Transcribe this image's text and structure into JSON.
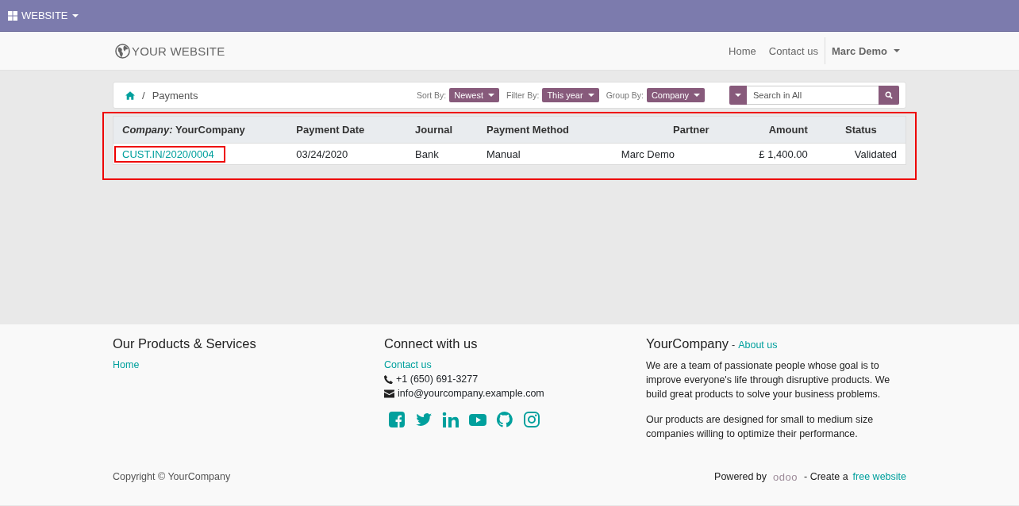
{
  "admin_bar": {
    "app_menu": "WEBSITE"
  },
  "header": {
    "logo": "YOUR WEBSITE",
    "nav": [
      "Home",
      "Contact us"
    ],
    "user": "Marc Demo"
  },
  "breadcrumb": {
    "separator": "/",
    "current": "Payments"
  },
  "controls": [
    {
      "label": "Sort By:",
      "value": "Newest"
    },
    {
      "label": "Filter By:",
      "value": "This year"
    },
    {
      "label": "Group By:",
      "value": "Company"
    }
  ],
  "search": {
    "placeholder": "Search in All"
  },
  "table": {
    "highlighted": true,
    "columns": [
      "*Company:* YourCompany",
      "Payment Date",
      "Journal",
      "Payment Method",
      "Partner",
      "Amount",
      "Status"
    ],
    "rows": [
      {
        "highlighted": true,
        "cells": [
          "CUST.IN/2020/0004",
          "03/24/2020",
          "Bank",
          "Manual",
          "Marc Demo",
          "£ 1,400.00",
          "Validated"
        ]
      }
    ]
  },
  "footer": {
    "products": {
      "title": "Our Products & Services",
      "links": [
        "Home"
      ]
    },
    "connect": {
      "title": "Connect with us",
      "link": "Contact us",
      "phone": "+1 (650) 691-3277",
      "email": "info@yourcompany.example.com"
    },
    "about": {
      "title": "YourCompany",
      "separator": "-",
      "link": "About us",
      "paragraphs": [
        "We are a team of passionate people whose goal is to improve everyone's life through disruptive products. We build great products to solve your business problems.",
        "Our products are designed for small to medium size companies willing to optimize their performance."
      ]
    },
    "copyright": "Copyright © YourCompany",
    "powered_by": "Powered by",
    "odoo": "odoo",
    "create": "- Create a",
    "create_link": "free website"
  }
}
